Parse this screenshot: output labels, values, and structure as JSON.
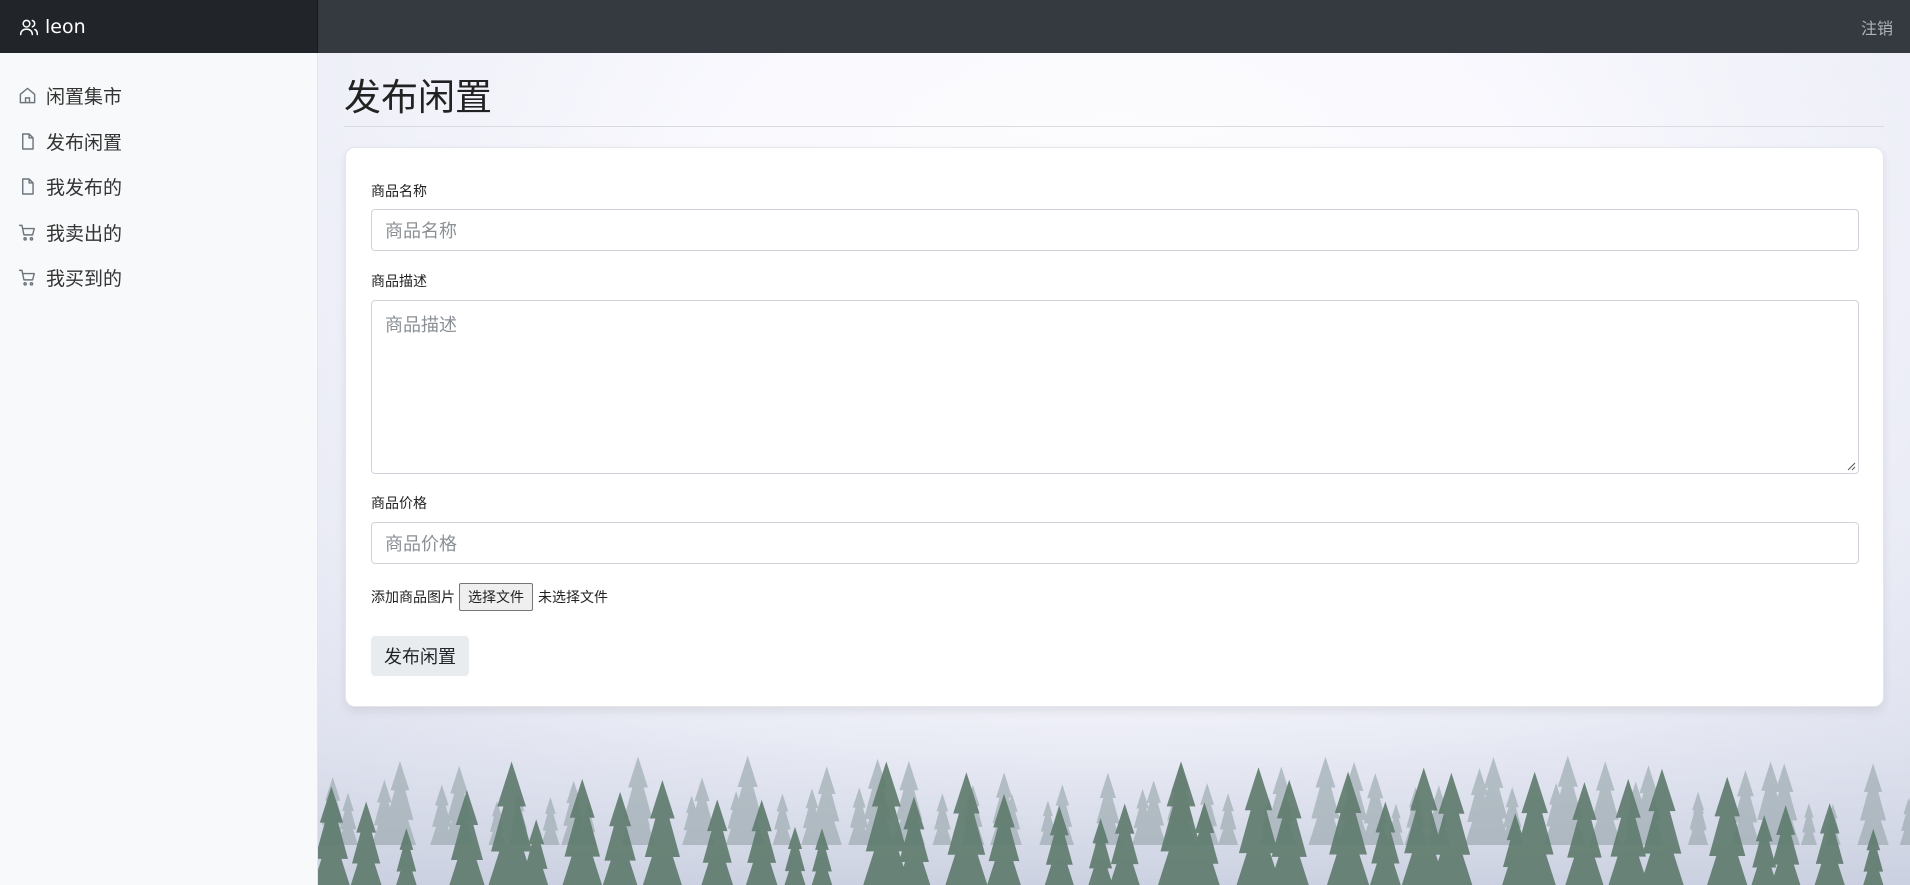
{
  "header": {
    "username": "leon",
    "logout_label": "注销"
  },
  "sidebar": {
    "items": [
      {
        "label": "闲置集市",
        "icon": "home-icon"
      },
      {
        "label": "发布闲置",
        "icon": "file-icon"
      },
      {
        "label": "我发布的",
        "icon": "file-icon"
      },
      {
        "label": "我卖出的",
        "icon": "cart-icon"
      },
      {
        "label": "我买到的",
        "icon": "cart-icon"
      }
    ]
  },
  "page": {
    "title": "发布闲置"
  },
  "form": {
    "name_label": "商品名称",
    "name_placeholder": "商品名称",
    "desc_label": "商品描述",
    "desc_placeholder": "商品描述",
    "price_label": "商品价格",
    "price_placeholder": "商品价格",
    "image_label": "添加商品图片",
    "file_button": "选择文件",
    "file_status": "未选择文件",
    "submit_label": "发布闲置"
  }
}
